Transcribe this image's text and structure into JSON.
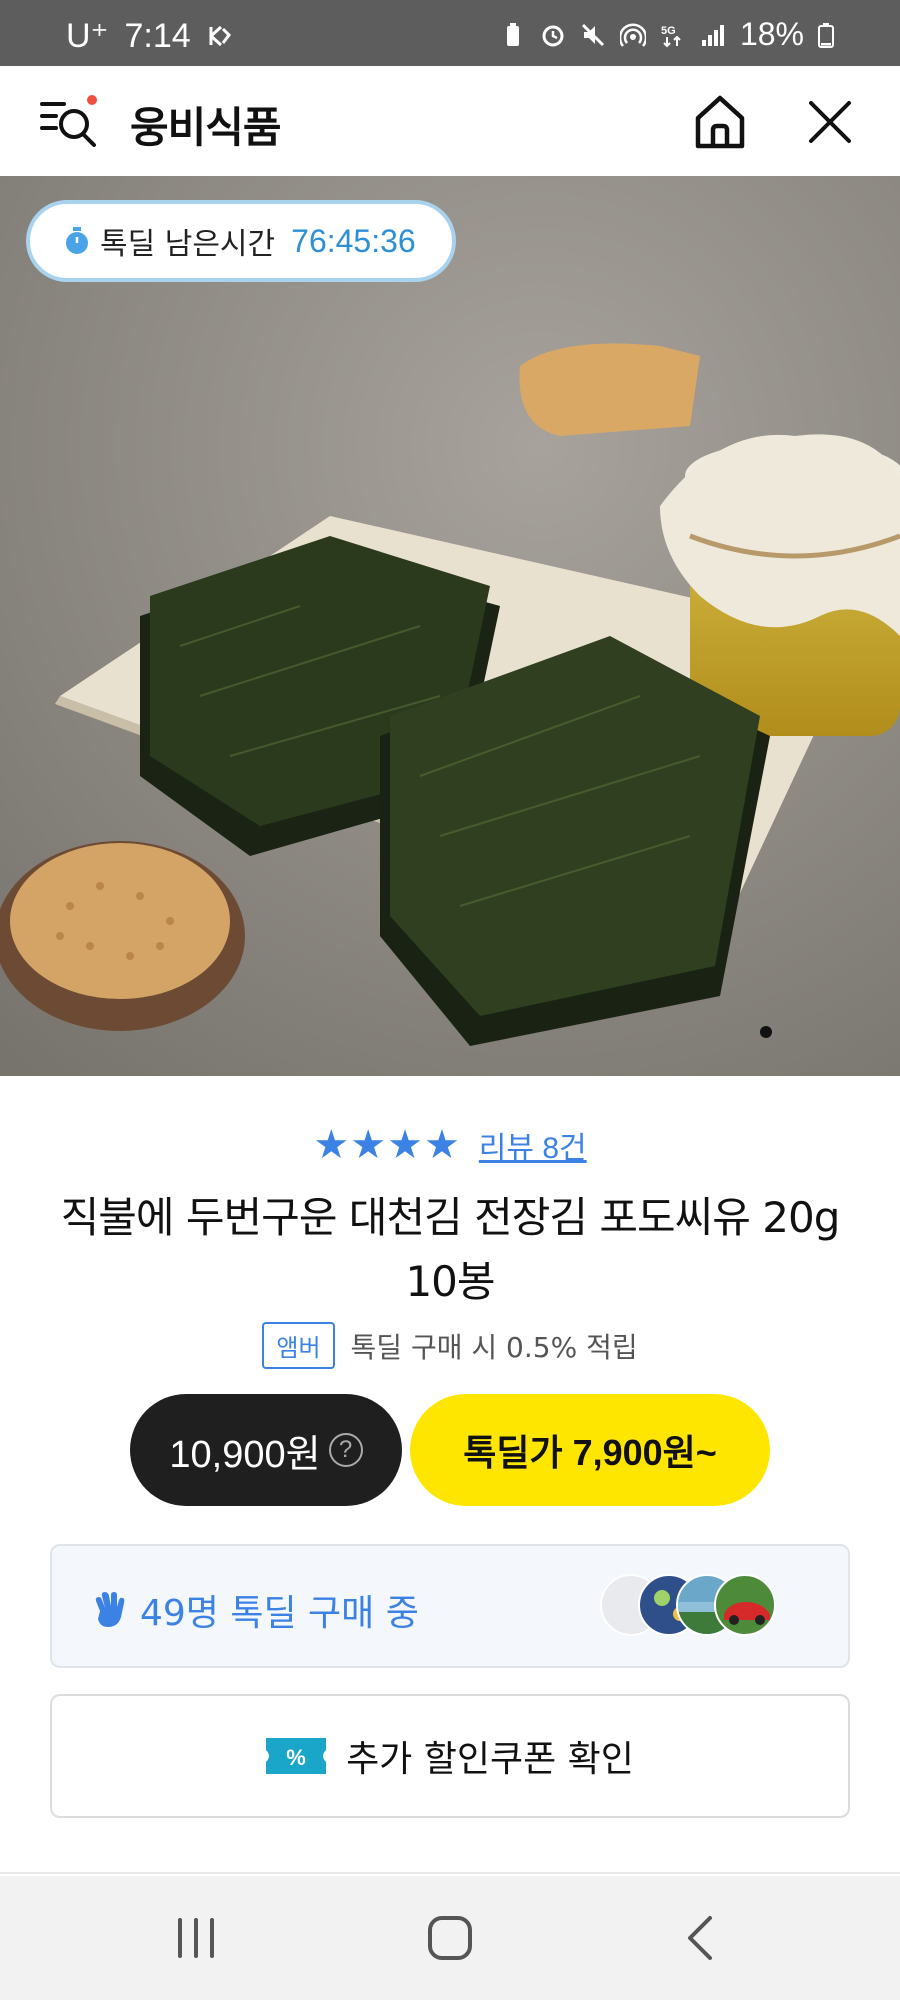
{
  "status_bar": {
    "carrier": "U⁺",
    "time": "7:14",
    "battery": "18%",
    "icons": [
      "notification-k-icon",
      "battery-saver-icon",
      "alarm-icon",
      "mute-icon",
      "hotspot-icon",
      "5g-icon",
      "signal-icon",
      "battery-icon"
    ]
  },
  "header": {
    "title": "웅비식품",
    "icons": [
      "search-menu-icon",
      "home-icon",
      "close-icon"
    ]
  },
  "hero": {
    "timer_label": "톡딜 남은시간",
    "timer_value": "76:45:36",
    "image_name": "seasoned-laver-product-photo"
  },
  "product": {
    "stars": "★★★★",
    "rating_value": 4,
    "review_link": "리뷰 8건",
    "title": "직불에 두번구운 대천김 전장김 포도씨유 20g 10봉",
    "benefit_badge": "앰버",
    "benefit_text": "톡딜 구매 시 0.5% 적립",
    "price_original": "10,900원",
    "price_help_symbol": "?",
    "price_deal": "톡딜가 7,900원~"
  },
  "buyers": {
    "text": "49명 톡딜 구매 중"
  },
  "coupon": {
    "icon_text": "%",
    "text": "추가 할인쿠폰 확인"
  },
  "colors": {
    "accent_blue": "#3c82e4",
    "deal_yellow": "#ffe600",
    "dark": "#1f1f1f",
    "status_bar": "#5d5d5d"
  }
}
